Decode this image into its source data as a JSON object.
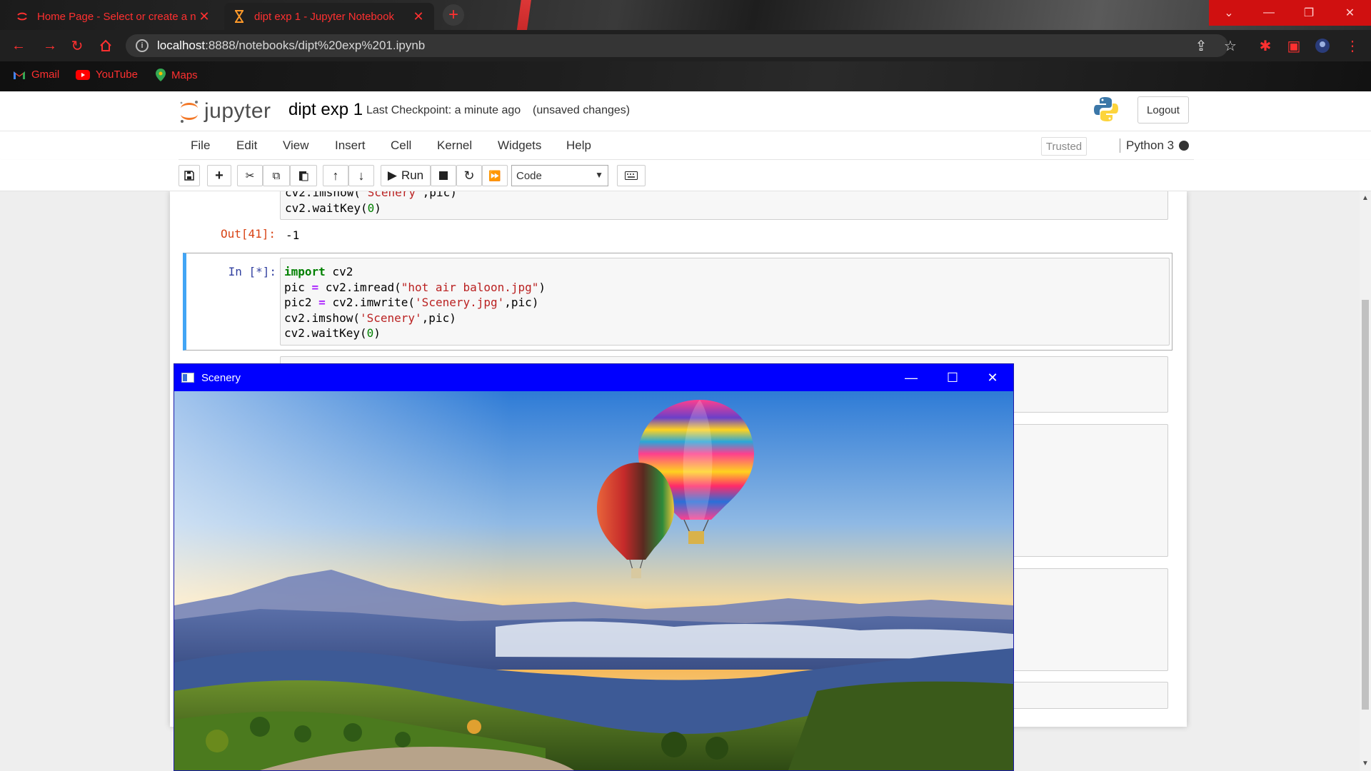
{
  "browser": {
    "tabs": [
      {
        "title": "Home Page - Select or create a n",
        "active": false
      },
      {
        "title": "dipt exp 1 - Jupyter Notebook",
        "active": true
      }
    ],
    "new_tab": "+",
    "address": {
      "host": "localhost",
      "rest": ":8888/notebooks/dipt%20exp%201.ipynb"
    },
    "bookmarks": [
      "Gmail",
      "YouTube",
      "Maps"
    ]
  },
  "jupyter": {
    "logo_text": "jupyter",
    "notebook_name": "dipt exp 1",
    "checkpoint": "Last Checkpoint: a minute ago",
    "unsaved": "(unsaved changes)",
    "logout": "Logout",
    "menus": [
      "File",
      "Edit",
      "View",
      "Insert",
      "Cell",
      "Kernel",
      "Widgets",
      "Help"
    ],
    "trusted": "Trusted",
    "kernel": "Python 3",
    "toolbar": {
      "run_label": "Run",
      "cell_type": "Code"
    }
  },
  "cells": {
    "prev": {
      "line1": {
        "a": "cv2.imshow(",
        "b": "'Scenery'",
        "c": ",pic)"
      },
      "line2": {
        "a": "cv2.waitKey(",
        "b": "0",
        "c": ")"
      },
      "out_prompt": "Out[41]:",
      "out_value": "-1"
    },
    "current": {
      "prompt": "In [*]:",
      "line1": {
        "kw": "import",
        "rest": " cv2"
      },
      "line2": {
        "a": "pic ",
        "op": "=",
        "b": " cv2.imread(",
        "str": "\"hot air baloon.jpg\"",
        "c": ")"
      },
      "line3": {
        "a": "pic2 ",
        "op": "=",
        "b": " cv2.imwrite(",
        "str": "'Scenery.jpg'",
        "c": ",pic)"
      },
      "line4": {
        "a": "cv2.imshow(",
        "str": "'Scenery'",
        "c": ",pic)"
      },
      "line5": {
        "a": "cv2.waitKey(",
        "num": "0",
        "c": ")"
      }
    }
  },
  "cv_window": {
    "title": "Scenery"
  },
  "colors": {
    "accent_red": "#ff3030",
    "selected_cell": "#42a5f5",
    "cv_titlebar": "#0000ff"
  }
}
